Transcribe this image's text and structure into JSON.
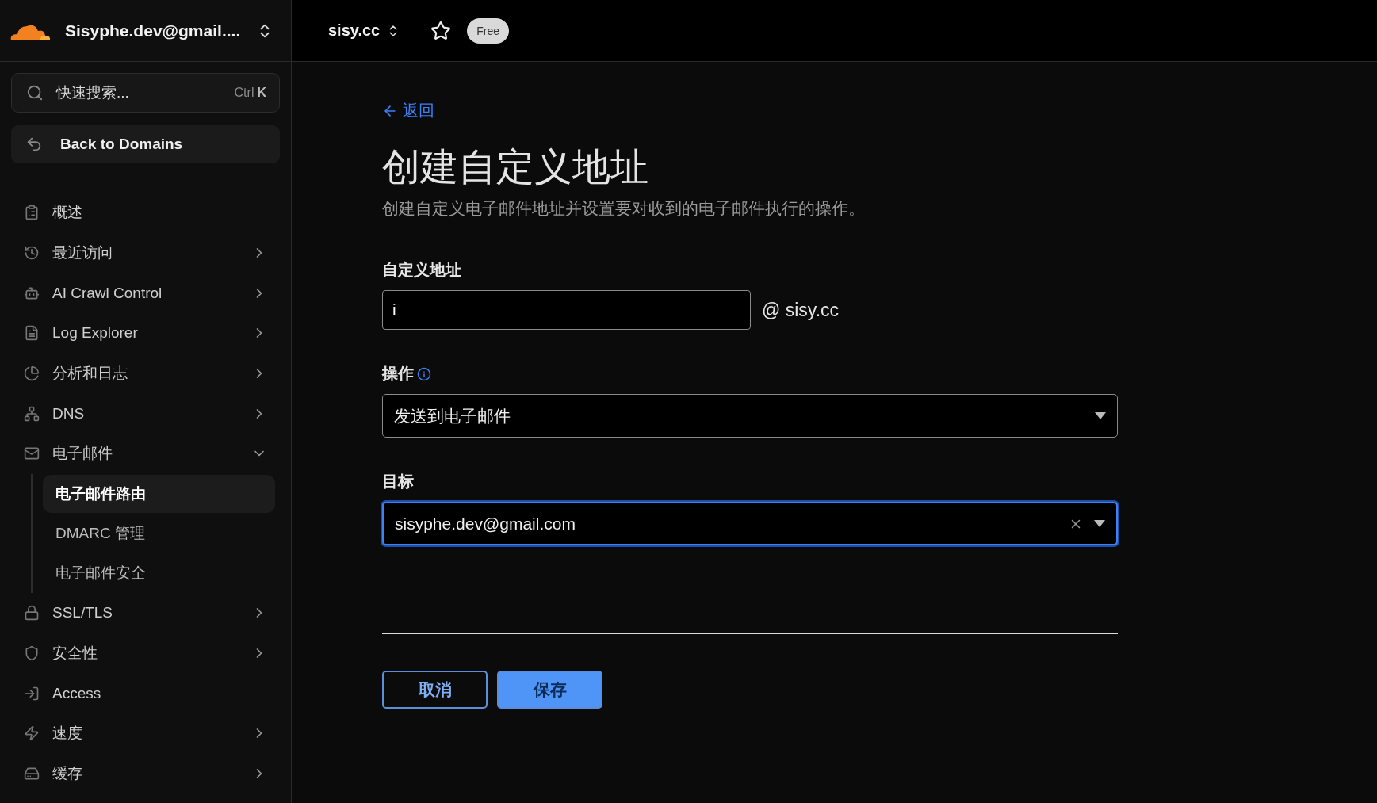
{
  "account": {
    "name": "Sisyphe.dev@gmail...."
  },
  "topbar": {
    "domain": "sisy.cc",
    "starred": false,
    "plan_badge": "Free"
  },
  "search": {
    "placeholder": "快速搜索...",
    "shortcut_modifier": "Ctrl",
    "shortcut_key": "K"
  },
  "back_to_domains": "Back to Domains",
  "sidebar": {
    "items": [
      {
        "label": "概述"
      },
      {
        "label": "最近访问",
        "expanded": false
      },
      {
        "label": "AI Crawl Control",
        "expanded": false
      },
      {
        "label": "Log Explorer",
        "expanded": false
      },
      {
        "label": "分析和日志",
        "expanded": false
      },
      {
        "label": "DNS",
        "expanded": false
      },
      {
        "label": "电子邮件",
        "expanded": true,
        "children": [
          {
            "label": "电子邮件路由",
            "selected": true
          },
          {
            "label": "DMARC 管理",
            "selected": false
          },
          {
            "label": "电子邮件安全",
            "selected": false
          }
        ]
      },
      {
        "label": "SSL/TLS",
        "expanded": false
      },
      {
        "label": "安全性",
        "expanded": false
      },
      {
        "label": "Access"
      },
      {
        "label": "速度",
        "expanded": false
      },
      {
        "label": "缓存",
        "expanded": false
      }
    ]
  },
  "form": {
    "back_link": "返回",
    "title": "创建自定义地址",
    "subtitle": "创建自定义电子邮件地址并设置要对收到的电子邮件执行的操作。",
    "custom_address": {
      "label": "自定义地址",
      "value": "i",
      "at": "@",
      "domain": "sisy.cc"
    },
    "action": {
      "label": "操作",
      "value": "发送到电子邮件"
    },
    "target": {
      "label": "目标",
      "value": "sisyphe.dev@gmail.com",
      "focused": true
    },
    "buttons": {
      "cancel": "取消",
      "save": "保存"
    }
  }
}
